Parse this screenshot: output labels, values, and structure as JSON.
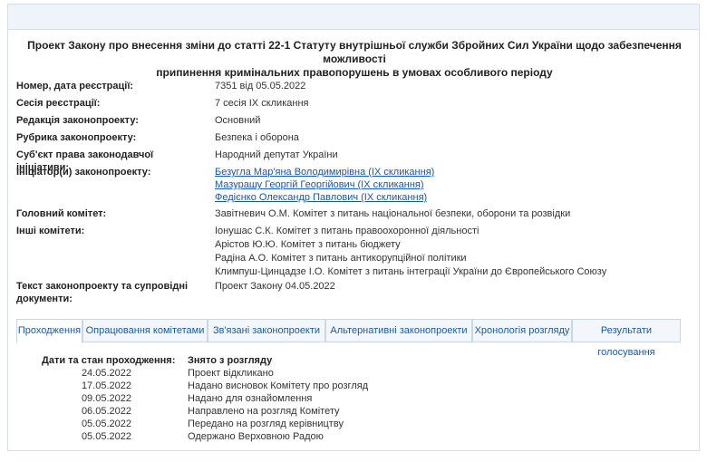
{
  "bill": {
    "title_line1": "Проект Закону про внесення зміни до статті 22-1 Статуту внутрішньої служби Збройних Сил України щодо забезпечення можливості",
    "title_line2": "припинення кримінальних правопорушень в умовах особливого періоду",
    "fields": [
      {
        "label": "Номер, дата реєстрації:",
        "values": [
          "7351 від 05.05.2022"
        ]
      },
      {
        "label": "Сесія реєстрації:",
        "values": [
          "7 сесія IX скликання"
        ]
      },
      {
        "label": "Редакція законопроекту:",
        "values": [
          "Основний"
        ]
      },
      {
        "label": "Рубрика законопроекту:",
        "values": [
          "Безпека і оборона"
        ]
      },
      {
        "label": "Суб'єкт права законодавчої ініціативи:",
        "values": [
          "Народний депутат України"
        ]
      },
      {
        "label": "Ініціатор(и) законопроекту:",
        "links": [
          "Безугла Мар'яна Володимирівна (IX скликання)",
          "Мазурашу Георгій Георгійович (IX скликання)",
          "Федієнко Олександр Павлович (IX скликання)"
        ]
      },
      {
        "label": "Головний комітет:",
        "values": [
          "Завітневич О.М. Комітет з питань національної безпеки, оборони та розвідки"
        ]
      },
      {
        "label": "Інші комітети:",
        "values": [
          "Іонушас С.К. Комітет з питань правоохоронної діяльності",
          "Арістов Ю.Ю. Комітет з питань бюджету",
          "Радіна А.О. Комітет з питань антикорупційної політики",
          "Климпуш-Цинцадзе І.О. Комітет з питань інтеграції України до Європейського Союзу"
        ]
      },
      {
        "label_line1": "Текст законопроекту та супровідні",
        "label_line2": "документи:",
        "values": [
          "Проект Закону 04.05.2022"
        ]
      }
    ]
  },
  "tabs": [
    {
      "label": "Проходження",
      "active": true
    },
    {
      "label": "Опрацювання комітетами",
      "active": false
    },
    {
      "label": "Зв'язані законопроекти",
      "active": false
    },
    {
      "label": "Альтернативні законопроекти",
      "active": false
    },
    {
      "label": "Хронологія розгляду",
      "active": false
    },
    {
      "label": "Результати голосування",
      "active": false
    }
  ],
  "passage": {
    "header_date": "Дати та стан проходження:",
    "header_status": "Знято з розгляду",
    "entries": [
      {
        "date": "24.05.2022",
        "text": "Проект відкликано"
      },
      {
        "date": "17.05.2022",
        "text": "Надано висновок Комітету про розгляд"
      },
      {
        "date": "09.05.2022",
        "text": "Надано для ознайомлення"
      },
      {
        "date": "06.05.2022",
        "text": "Направлено на розгляд Комітету"
      },
      {
        "date": "05.05.2022",
        "text": "Передано на розгляд керівництву"
      },
      {
        "date": "05.05.2022",
        "text": "Одержано Верховною Радою"
      }
    ]
  }
}
